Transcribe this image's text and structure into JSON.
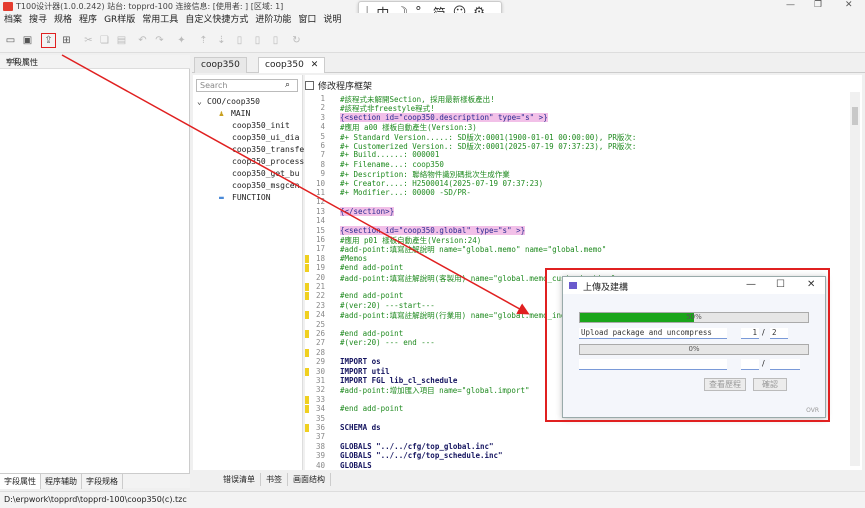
{
  "window": {
    "title": "T100设计器(1.0.0.242) 站台: topprd-100 连接信息: [使用者:                  ] [区域: 1]"
  },
  "menu": [
    "档案",
    "搜寻",
    "规格",
    "程序",
    "GR样版",
    "常用工具",
    "自定义快捷方式",
    "进阶功能",
    "窗口",
    "说明"
  ],
  "ime": {
    "items": [
      "中",
      "°,",
      "简"
    ]
  },
  "left_panel": {
    "title": "字段属性",
    "tabs": [
      "字段属性",
      "程序辅助",
      "字段规格"
    ]
  },
  "doc_tabs": [
    "coop350",
    "coop350"
  ],
  "tree": {
    "search_placeholder": "Search",
    "items": [
      "COO/coop350",
      "MAIN",
      "coop350_init",
      "coop350_ui_dia",
      "coop350_transfe",
      "coop350_process",
      "coop350_get_bu",
      "coop350_msgcen",
      "FUNCTION"
    ]
  },
  "editor": {
    "checkbox_label": "修改程序框架",
    "line_numbers": [
      "1",
      "2",
      "3",
      "4",
      "5",
      "6",
      "7",
      "8",
      "9",
      "10",
      "11",
      "12",
      "13",
      "14",
      "15",
      "16",
      "17",
      "18",
      "19",
      "20",
      "21",
      "22",
      "23",
      "24",
      "25",
      "26",
      "27",
      "28",
      "29",
      "30",
      "31",
      "32",
      "33",
      "34",
      "35",
      "36",
      "37",
      "38",
      "39",
      "40"
    ],
    "lines": [
      "#該程式未解開Section, 採用最新樣板產出!",
      "#該程式非freestyle程式!",
      "{<section id=\"coop350.description\" type=\"s\" >}",
      "#應用 a00 樣板自動產生(Version:3)",
      "#+ Standard Version.....: SD版次:0001(1900-01-01 00:00:00), PR版次:",
      "#+ Customerized Version.: SD版次:0001(2025-07-19 07:37:23), PR版次:",
      "#+ Build......: 000001",
      "#+ Filename...: coop350",
      "#+ Description: 聯絡物件識別碼批次生成作業",
      "#+ Creator....: H2500014(2025-07-19 07:37:23)",
      "#+ Modifier...: 00000 -SD/PR-",
      "",
      "{</section>}",
      "",
      "{<section id=\"coop350.global\" type=\"s\" >}",
      "#應用 p01 樣板自動產生(Version:24)",
      "#add-point:填寫註解說明 name=\"global.memo\" name=\"global.memo\"",
      "#Memos",
      "#end add-point",
      "#add-point:填寫註解說明(客製用) name=\"global.memo_customization\"",
      "",
      "#end add-point",
      "#(ver:20) ---start---",
      "#add-point:填寫註解說明(行業用) name=\"global.memo_industry\"",
      "",
      "#end add-point",
      "#(ver:20) --- end ---",
      "",
      "IMPORT os",
      "IMPORT util",
      "IMPORT FGL lib_cl_schedule",
      "#add-point:增加匯入項目 name=\"global.import\"",
      "",
      "#end add-point",
      "",
      "SCHEMA ds",
      "",
      "GLOBALS \"../../cfg/top_global.inc\"",
      "GLOBALS \"../../cfg/top_schedule.inc\"",
      "GLOBALS"
    ]
  },
  "bottom_tabs": [
    "错误清单",
    "书签",
    "画面结构"
  ],
  "status": {
    "path": "D:\\erpwork\\topprd\\topprd-100\\coop350(c).tzc"
  },
  "dialog": {
    "title": "上傳及建構",
    "progress1": {
      "label": "50%",
      "value": 0.5
    },
    "task_text": "Upload package and uncompress",
    "step_current": "1",
    "step_total": "2",
    "progress2": {
      "label": "0%",
      "value": 0.0
    },
    "task2_text": "",
    "step2_current": "",
    "step2_total": "",
    "btn_history": "查看歷程",
    "btn_ok": "確認",
    "ovr": "OVR"
  },
  "colors": {
    "accent_red": "#e02020",
    "progress_green": "#1aa51a",
    "tag_pink": "#f2c0e8"
  }
}
